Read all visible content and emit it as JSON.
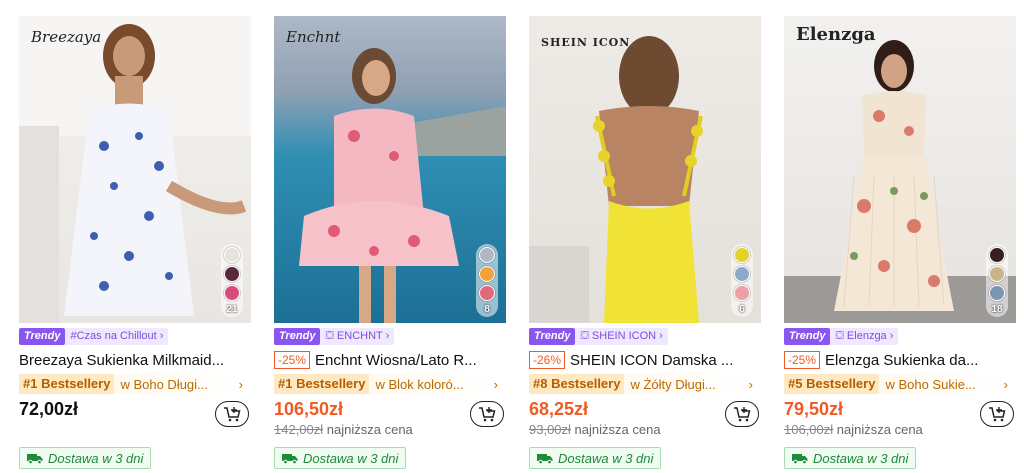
{
  "products": [
    {
      "brand_logo": "Breezaya",
      "tag_badge": "Trendy",
      "tag_text": "#Czas na Chillout ›",
      "discount": "",
      "title": "Breezaya Sukienka Milkmaid...",
      "bestseller": "#1 Bestsellery",
      "best_category": "w Boho Długi...",
      "price": "72,00zł",
      "old_price": "",
      "old_label": "",
      "swatch_count": "21",
      "delivery": "Dostawa w 3 dni",
      "swatch_colors": [
        "#e6e2dc",
        "#5a2a3a",
        "#d94b7c"
      ]
    },
    {
      "brand_logo": "Enchnt",
      "tag_badge": "Trendy",
      "tag_text": "ENCHNT ›",
      "discount": "-25%",
      "title": "Enchnt Wiosna/Lato R...",
      "bestseller": "#1 Bestsellery",
      "best_category": "w Blok koloró...",
      "price": "106,50zł",
      "old_price": "142,00zł",
      "old_label": "najniższa cena",
      "swatch_count": "8",
      "delivery": "Dostawa w 3 dni",
      "swatch_colors": [
        "#b0b7c8",
        "#f2a23a",
        "#e06a7a"
      ]
    },
    {
      "brand_logo": "SHEIN ICON",
      "tag_badge": "Trendy",
      "tag_text": "SHEIN ICON ›",
      "discount": "-26%",
      "title": "SHEIN ICON Damska ...",
      "bestseller": "#8 Bestsellery",
      "best_category": "w Żółty Długi...",
      "price": "68,25zł",
      "old_price": "93,00zł",
      "old_label": "najniższa cena",
      "swatch_count": "6",
      "delivery": "Dostawa w 3 dni",
      "swatch_colors": [
        "#e3d22a",
        "#8fa9c8",
        "#ec9fa6"
      ]
    },
    {
      "brand_logo": "Elenzga",
      "tag_badge": "Trendy",
      "tag_text": "Elenzga ›",
      "discount": "-25%",
      "title": "Elenzga Sukienka da...",
      "bestseller": "#5 Bestsellery",
      "best_category": "w Boho Sukie...",
      "price": "79,50zł",
      "old_price": "106,00zł",
      "old_label": "najniższa cena",
      "swatch_count": "18",
      "delivery": "Dostawa w 3 dni",
      "swatch_colors": [
        "#3a1f22",
        "#c8b48a",
        "#7d94b4"
      ]
    }
  ]
}
